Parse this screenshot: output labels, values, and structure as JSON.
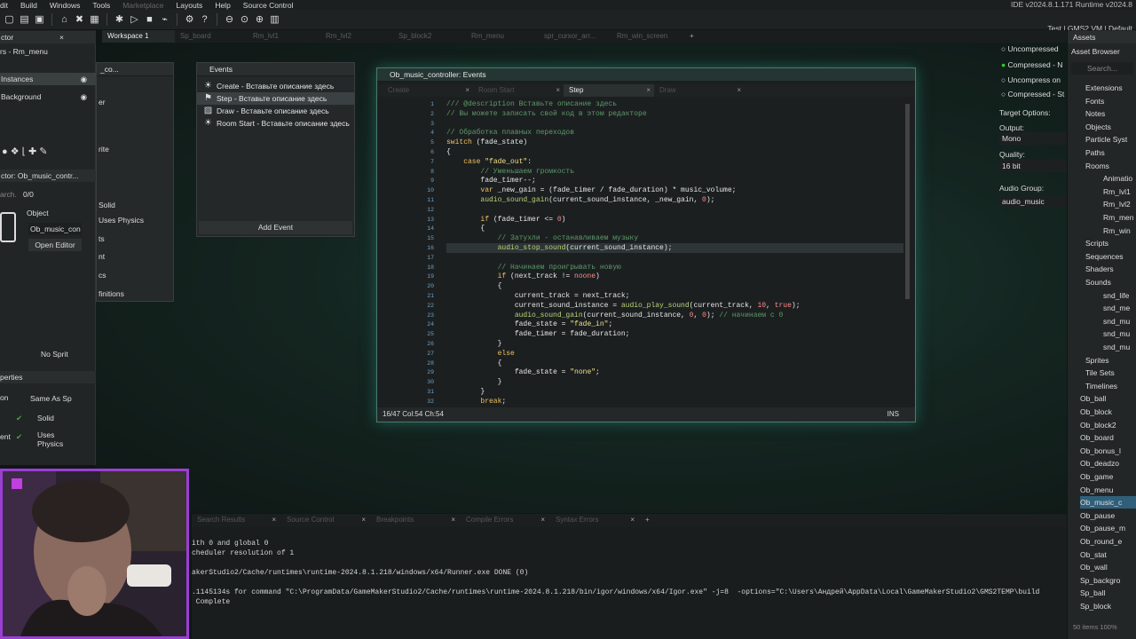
{
  "menu": [
    "dit",
    "Build",
    "Windows",
    "Tools",
    "Marketplace",
    "Layouts",
    "Help",
    "Source Control"
  ],
  "ide_version": "IDE v2024.8.1.171  Runtime v2024.8",
  "target": "Test | GMS2 VM | Default",
  "workspace_tabs": [
    "Workspace 1",
    "Sp_board",
    "Rm_lvl1",
    "Rm_lvl2",
    "Sp_block2",
    "Rm_menu",
    "spr_cursor_arr...",
    "Rm_win_screen"
  ],
  "left_panel": {
    "inspector_tab": "ctor",
    "room_label": "rs - Rm_menu",
    "instances": "Instances",
    "background": "Background",
    "inspector_obj": "ctor: Ob_music_contr...",
    "search": "arch.",
    "count": "0/0",
    "object_label": "Object",
    "object_name": "Ob_music_con",
    "open_editor": "Open Editor",
    "no_sprite": "No Sprit",
    "properties": "perties",
    "same_as": "Same As Sp",
    "solid": "Solid",
    "uses_physics": "Uses Physics",
    "on": "on",
    "ent": "ent"
  },
  "object_panel": {
    "title": "_co...",
    "er": "er",
    "rite": "rite",
    "solid": "Solid",
    "uses_physics": "Uses Physics",
    "ts": "ts",
    "nt": "nt",
    "cs": "cs",
    "definitions": "finitions"
  },
  "events_window": {
    "title": "Events",
    "items": [
      {
        "label": "Create - Вставьте описание здесь",
        "icon": "bulb-icon"
      },
      {
        "label": "Step - Вставьте описание здесь",
        "icon": "step-icon"
      },
      {
        "label": "Draw - Вставьте описание здесь",
        "icon": "draw-icon"
      },
      {
        "label": "Room Start - Вставьте описание здесь",
        "icon": "bulb-icon"
      }
    ],
    "add_event": "Add Event"
  },
  "code_window": {
    "title": "Ob_music_controller: Events",
    "tabs": [
      "Create",
      "Room Start",
      "Step",
      "Draw"
    ],
    "active_tab": "Step",
    "status": "16/47 Col:54 Ch:54",
    "mode": "INS",
    "line_numbers": [
      "1",
      "2",
      "3",
      "4",
      "5",
      "6",
      "7",
      "8",
      "9",
      "10",
      "11",
      "12",
      "13",
      "14",
      "15",
      "16",
      "17",
      "18",
      "19",
      "20",
      "21",
      "22",
      "23",
      "24",
      "25",
      "26",
      "27",
      "28",
      "29",
      "30",
      "31",
      "32"
    ]
  },
  "right_mid": {
    "compression": [
      "Uncompressed",
      "Compressed - N",
      "Uncompress on",
      "Compressed - St"
    ],
    "target_options": "Target Options:",
    "output_label": "Output:",
    "output_value": "Mono",
    "quality_label": "Quality:",
    "quality_value": "16 bit",
    "audio_group_label": "Audio Group:",
    "audio_group_value": "audio_music"
  },
  "assets": {
    "tab": "Assets",
    "browser": "Asset Browser",
    "search": "Search...",
    "items": [
      "Extensions",
      "Fonts",
      "Notes",
      "Objects",
      "Particle Syst",
      "Paths",
      "Rooms",
      "Animatio",
      "Rm_lvl1",
      "Rm_lvl2",
      "Rm_men",
      "Rm_win",
      "Scripts",
      "Sequences",
      "Shaders",
      "Sounds",
      "snd_life",
      "snd_me",
      "snd_mu",
      "snd_mu",
      "snd_mu",
      "Sprites",
      "Tile Sets",
      "Timelines",
      "Ob_ball",
      "Ob_block",
      "Ob_block2",
      "Ob_board",
      "Ob_bonus_l",
      "Ob_deadzo",
      "Ob_game",
      "Ob_menu",
      "Ob_music_c",
      "Ob_pause",
      "Ob_pause_m",
      "Ob_round_e",
      "Ob_stat",
      "Ob_wall",
      "Sp_backgro",
      "Sp_ball",
      "Sp_block"
    ],
    "footer": "50 items  100%"
  },
  "output_tabs": [
    "Search Results",
    "Source Control",
    "Breakpoints",
    "Compile Errors",
    "Syntax Errors"
  ],
  "output_lines": [
    "ith 0 and global 0",
    "cheduler resolution of 1",
    "",
    "akerStudio2/Cache/runtimes\\runtime-2024.8.1.218/windows/x64/Runner.exe DONE (0)",
    "",
    ".1145134s for command \"C:\\ProgramData/GameMakerStudio2/Cache/runtimes\\runtime-2024.8.1.218/bin/igor/windows/x64/Igor.exe\" -j=8  -options=\"C:\\Users\\Андрей\\AppData\\Local\\GameMakerStudio2\\GMS2TEMP\\build",
    " Complete"
  ]
}
